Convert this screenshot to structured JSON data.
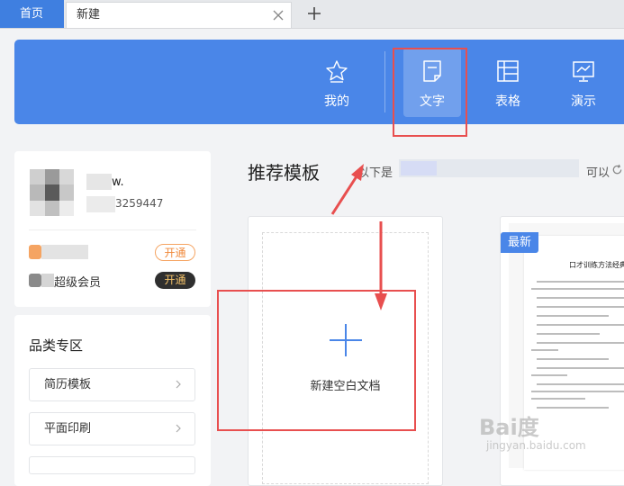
{
  "tabs": {
    "home": "首页",
    "new": "新建"
  },
  "nav": {
    "items": [
      {
        "label": "我的",
        "icon": "star-icon"
      },
      {
        "label": "文字",
        "icon": "document-icon",
        "active": true
      },
      {
        "label": "表格",
        "icon": "table-icon"
      },
      {
        "label": "演示",
        "icon": "presentation-icon"
      }
    ]
  },
  "profile": {
    "name_suffix": "w.",
    "id_suffix": "3259447",
    "rows": [
      {
        "label": "",
        "button": "开通",
        "style": "outline"
      },
      {
        "label": "超级会员",
        "button": "开通",
        "style": "dark"
      }
    ]
  },
  "category": {
    "title": "品类专区",
    "items": [
      "简历模板",
      "平面印刷",
      ""
    ]
  },
  "main": {
    "title": "推荐模板",
    "subtitle_prefix": "以下是",
    "subtitle_suffix": "可以",
    "blank_label": "新建空白文档"
  },
  "template_card": {
    "badge": "最新",
    "doc_title": "口才训练方法经典句子"
  },
  "watermark": {
    "brand": "Bai度",
    "sub": "jingyan.baidu.com"
  },
  "colors": {
    "accent": "#4a86e8",
    "highlight": "#e84f4f",
    "vip_orange": "#f5a462"
  }
}
